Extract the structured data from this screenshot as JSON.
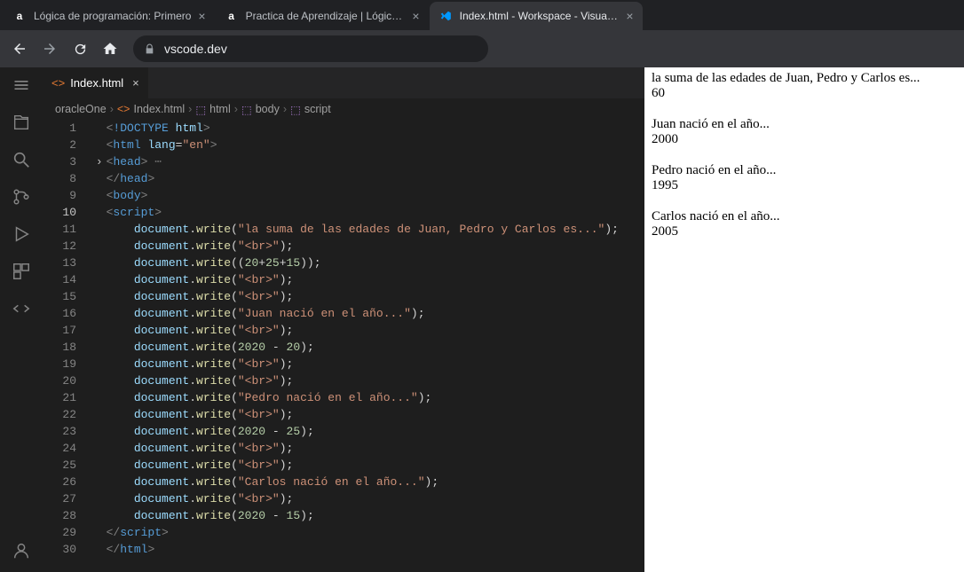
{
  "browser": {
    "tabs": [
      {
        "title": "Lógica de programación: Primero",
        "favicon": "a"
      },
      {
        "title": "Practica de Aprendizaje | Lógica d",
        "favicon": "a"
      },
      {
        "title": "Index.html - Workspace - Visual S",
        "favicon": "vs",
        "active": true
      }
    ],
    "url": "vscode.dev"
  },
  "editor": {
    "tabFile": "Index.html",
    "breadcrumbs": [
      "oracleOne",
      "Index.html",
      "html",
      "body",
      "script"
    ],
    "lines": [
      {
        "n": 1,
        "html": "<span class='tk-punct'>&lt;</span><span class='tk-doctype'>!DOCTYPE</span> <span class='tk-attr'>html</span><span class='tk-punct'>&gt;</span>"
      },
      {
        "n": 2,
        "html": "<span class='tk-punct'>&lt;</span><span class='tk-tag'>html</span> <span class='tk-attr'>lang</span><span class='tk-op'>=</span><span class='tk-string'>\"en\"</span><span class='tk-punct'>&gt;</span>"
      },
      {
        "n": 3,
        "html": "<span class='fold-arrow'>›</span><span class='tk-punct'>&lt;</span><span class='tk-tag'>head</span><span class='tk-punct'>&gt;</span> <span class='tk-dots'>⋯</span>"
      },
      {
        "n": 8,
        "html": "<span class='tk-punct'>&lt;/</span><span class='tk-tag'>head</span><span class='tk-punct'>&gt;</span>"
      },
      {
        "n": 9,
        "html": "<span class='tk-punct'>&lt;</span><span class='tk-tag'>body</span><span class='tk-punct'>&gt;</span>"
      },
      {
        "n": 10,
        "active": true,
        "html": "<span class='tk-punct'>&lt;</span><span class='tk-tag'>script</span><span class='tk-punct'>&gt;</span>"
      },
      {
        "n": 11,
        "indent": 4,
        "html": "<span class='tk-obj'>document</span><span class='tk-op'>.</span><span class='tk-fn'>write</span><span class='tk-op'>(</span><span class='tk-string'>\"la suma de las edades de Juan, Pedro y Carlos es...\"</span><span class='tk-op'>);</span>"
      },
      {
        "n": 12,
        "indent": 4,
        "html": "<span class='tk-obj'>document</span><span class='tk-op'>.</span><span class='tk-fn'>write</span><span class='tk-op'>(</span><span class='tk-string'>\"&lt;br&gt;\"</span><span class='tk-op'>);</span>"
      },
      {
        "n": 13,
        "indent": 4,
        "html": "<span class='tk-obj'>document</span><span class='tk-op'>.</span><span class='tk-fn'>write</span><span class='tk-op'>((</span><span class='tk-num'>20</span><span class='tk-op'>+</span><span class='tk-num'>25</span><span class='tk-op'>+</span><span class='tk-num'>15</span><span class='tk-op'>));</span>"
      },
      {
        "n": 14,
        "indent": 4,
        "html": "<span class='tk-obj'>document</span><span class='tk-op'>.</span><span class='tk-fn'>write</span><span class='tk-op'>(</span><span class='tk-string'>\"&lt;br&gt;\"</span><span class='tk-op'>);</span>"
      },
      {
        "n": 15,
        "indent": 4,
        "html": "<span class='tk-obj'>document</span><span class='tk-op'>.</span><span class='tk-fn'>write</span><span class='tk-op'>(</span><span class='tk-string'>\"&lt;br&gt;\"</span><span class='tk-op'>);</span>"
      },
      {
        "n": 16,
        "indent": 4,
        "html": "<span class='tk-obj'>document</span><span class='tk-op'>.</span><span class='tk-fn'>write</span><span class='tk-op'>(</span><span class='tk-string'>\"Juan nació en el año...\"</span><span class='tk-op'>);</span>"
      },
      {
        "n": 17,
        "indent": 4,
        "html": "<span class='tk-obj'>document</span><span class='tk-op'>.</span><span class='tk-fn'>write</span><span class='tk-op'>(</span><span class='tk-string'>\"&lt;br&gt;\"</span><span class='tk-op'>);</span>"
      },
      {
        "n": 18,
        "indent": 4,
        "html": "<span class='tk-obj'>document</span><span class='tk-op'>.</span><span class='tk-fn'>write</span><span class='tk-op'>(</span><span class='tk-num'>2020</span> <span class='tk-op'>-</span> <span class='tk-num'>20</span><span class='tk-op'>);</span>"
      },
      {
        "n": 19,
        "indent": 4,
        "html": "<span class='tk-obj'>document</span><span class='tk-op'>.</span><span class='tk-fn'>write</span><span class='tk-op'>(</span><span class='tk-string'>\"&lt;br&gt;\"</span><span class='tk-op'>);</span>"
      },
      {
        "n": 20,
        "indent": 4,
        "html": "<span class='tk-obj'>document</span><span class='tk-op'>.</span><span class='tk-fn'>write</span><span class='tk-op'>(</span><span class='tk-string'>\"&lt;br&gt;\"</span><span class='tk-op'>);</span>"
      },
      {
        "n": 21,
        "indent": 4,
        "html": "<span class='tk-obj'>document</span><span class='tk-op'>.</span><span class='tk-fn'>write</span><span class='tk-op'>(</span><span class='tk-string'>\"Pedro nació en el año...\"</span><span class='tk-op'>);</span>"
      },
      {
        "n": 22,
        "indent": 4,
        "html": "<span class='tk-obj'>document</span><span class='tk-op'>.</span><span class='tk-fn'>write</span><span class='tk-op'>(</span><span class='tk-string'>\"&lt;br&gt;\"</span><span class='tk-op'>);</span>"
      },
      {
        "n": 23,
        "indent": 4,
        "html": "<span class='tk-obj'>document</span><span class='tk-op'>.</span><span class='tk-fn'>write</span><span class='tk-op'>(</span><span class='tk-num'>2020</span> <span class='tk-op'>-</span> <span class='tk-num'>25</span><span class='tk-op'>);</span>"
      },
      {
        "n": 24,
        "indent": 4,
        "html": "<span class='tk-obj'>document</span><span class='tk-op'>.</span><span class='tk-fn'>write</span><span class='tk-op'>(</span><span class='tk-string'>\"&lt;br&gt;\"</span><span class='tk-op'>);</span>"
      },
      {
        "n": 25,
        "indent": 4,
        "html": "<span class='tk-obj'>document</span><span class='tk-op'>.</span><span class='tk-fn'>write</span><span class='tk-op'>(</span><span class='tk-string'>\"&lt;br&gt;\"</span><span class='tk-op'>);</span>"
      },
      {
        "n": 26,
        "indent": 4,
        "html": "<span class='tk-obj'>document</span><span class='tk-op'>.</span><span class='tk-fn'>write</span><span class='tk-op'>(</span><span class='tk-string'>\"Carlos nació en el año...\"</span><span class='tk-op'>);</span>"
      },
      {
        "n": 27,
        "indent": 4,
        "html": "<span class='tk-obj'>document</span><span class='tk-op'>.</span><span class='tk-fn'>write</span><span class='tk-op'>(</span><span class='tk-string'>\"&lt;br&gt;\"</span><span class='tk-op'>);</span>"
      },
      {
        "n": 28,
        "indent": 4,
        "html": "<span class='tk-obj'>document</span><span class='tk-op'>.</span><span class='tk-fn'>write</span><span class='tk-op'>(</span><span class='tk-num'>2020</span> <span class='tk-op'>-</span> <span class='tk-num'>15</span><span class='tk-op'>);</span>"
      },
      {
        "n": 29,
        "html": "<span class='tk-punct'>&lt;/</span><span class='tk-tag'>script</span><span class='tk-punct'>&gt;</span>"
      },
      {
        "n": 30,
        "html": "<span class='tk-punct'>&lt;/</span><span class='tk-tag'>html</span><span class='tk-punct'>&gt;</span>"
      }
    ]
  },
  "output": [
    {
      "label": "la suma de las edades de Juan, Pedro y Carlos es...",
      "value": "60"
    },
    {
      "label": "Juan nació en el año...",
      "value": "2000"
    },
    {
      "label": "Pedro nació en el año...",
      "value": "1995"
    },
    {
      "label": "Carlos nació en el año...",
      "value": "2005"
    }
  ]
}
